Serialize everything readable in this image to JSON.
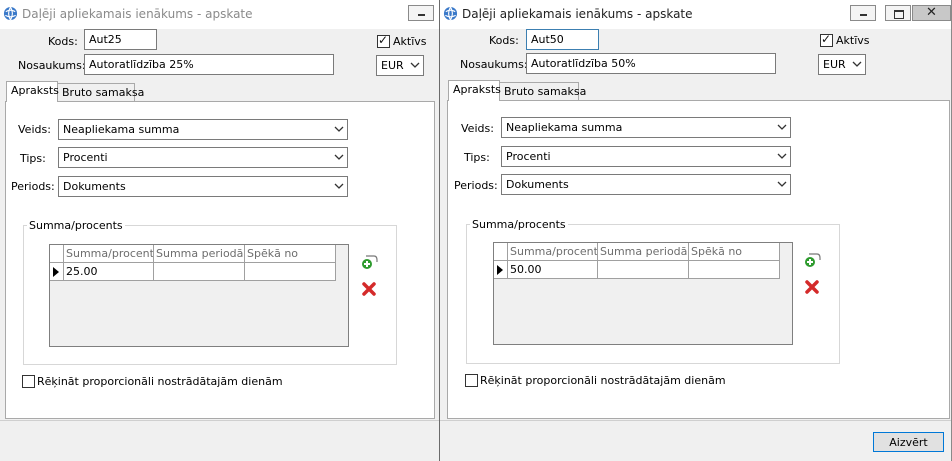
{
  "window_left": {
    "title": "Daļēji apliekamais ienākums - apskate",
    "kods_label": "Kods:",
    "kods_value": "Aut25",
    "nosaukums_label": "Nosaukums:",
    "nosaukums_value": "Autoratlīdzība 25%",
    "aktivs_label": "Aktīvs",
    "aktivs_checked": true,
    "currency": "EUR",
    "tabs": [
      "Apraksts",
      "Bruto samaksa"
    ],
    "active_tab": 0,
    "veids_label": "Veids:",
    "veids_value": "Neapliekama summa",
    "tips_label": "Tips:",
    "tips_value": "Procenti",
    "periods_label": "Periods:",
    "periods_value": "Dokuments",
    "group_label": "Summa/procents",
    "grid_columns": [
      "Summa/procents",
      "Summa periodā",
      "Spēkā no"
    ],
    "grid_rows": [
      [
        "25.00",
        "",
        ""
      ]
    ],
    "proportional_label": "Rēķināt proporcionāli nostrādātajām dienām",
    "proportional_checked": false
  },
  "window_right": {
    "title": "Daļēji apliekamais ienākums - apskate",
    "kods_label": "Kods:",
    "kods_value": "Aut50",
    "nosaukums_label": "Nosaukums:",
    "nosaukums_value": "Autoratlīdzība 50%",
    "aktivs_label": "Aktīvs",
    "aktivs_checked": true,
    "currency": "EUR",
    "tabs": [
      "Apraksts",
      "Bruto samaksa"
    ],
    "active_tab": 0,
    "veids_label": "Veids:",
    "veids_value": "Neapliekama summa",
    "tips_label": "Tips:",
    "tips_value": "Procenti",
    "periods_label": "Periods:",
    "periods_value": "Dokuments",
    "group_label": "Summa/procents",
    "grid_columns": [
      "Summa/procents",
      "Summa periodā",
      "Spēkā no"
    ],
    "grid_rows": [
      [
        "50.00",
        "",
        ""
      ]
    ],
    "proportional_label": "Rēķināt proporcionāli nostrādātajām dienām",
    "proportional_checked": false,
    "close_button": "Aizvērt"
  },
  "icons": {
    "app": "app-globe-icon",
    "add_row": "add-row-icon",
    "delete_row": "delete-row-icon",
    "dropdown": "chevron-down-icon"
  },
  "colors": {
    "window_bg": "#f0f0f0",
    "focus_border": "#3c7fb1",
    "button_border": "#0078d7",
    "add_icon": "#2e9b2e",
    "delete_icon": "#d42a2a"
  }
}
